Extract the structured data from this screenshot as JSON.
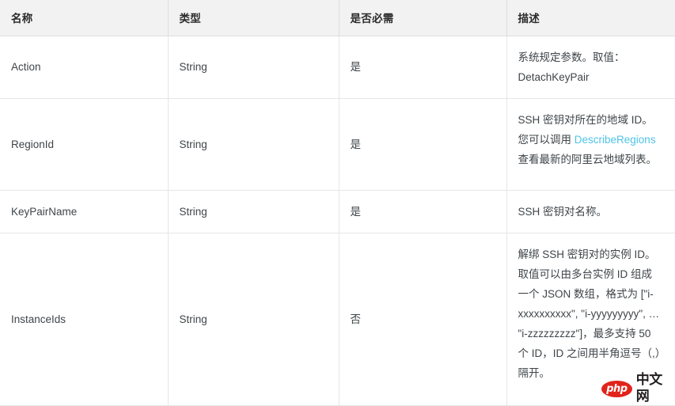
{
  "table": {
    "columns": [
      {
        "key": "name",
        "label": "名称"
      },
      {
        "key": "type",
        "label": "类型"
      },
      {
        "key": "required",
        "label": "是否必需"
      },
      {
        "key": "desc",
        "label": "描述"
      }
    ],
    "rows": [
      {
        "name": "Action",
        "type": "String",
        "required": "是",
        "desc_before": "系统规定参数。取值：DetachKeyPair",
        "link": "",
        "desc_after": ""
      },
      {
        "name": "RegionId",
        "type": "String",
        "required": "是",
        "desc_before": "SSH 密钥对所在的地域 ID。您可以调用 ",
        "link": "DescribeRegions",
        "desc_after": " 查看最新的阿里云地域列表。"
      },
      {
        "name": "KeyPairName",
        "type": "String",
        "required": "是",
        "desc_before": "SSH 密钥对名称。",
        "link": "",
        "desc_after": ""
      },
      {
        "name": "InstanceIds",
        "type": "String",
        "required": "否",
        "desc_before": "解绑 SSH 密钥对的实例 ID。取值可以由多台实例 ID 组成一个 JSON 数组，格式为 [\"i-xxxxxxxxxx\", \"i-yyyyyyyyy\", … \"i-zzzzzzzzz\"]，最多支持 50 个 ID，ID 之间用半角逗号（,）隔开。",
        "link": "",
        "desc_after": ""
      }
    ]
  },
  "watermark": {
    "badge_text": "php",
    "site_text": "中文网",
    "badge_color": "#e2231a",
    "text_color": "#231f20"
  },
  "colors": {
    "link": "#4ec3e8",
    "header_bg": "#f2f2f2",
    "border": "#e6e6e6",
    "text": "#3f4549"
  }
}
